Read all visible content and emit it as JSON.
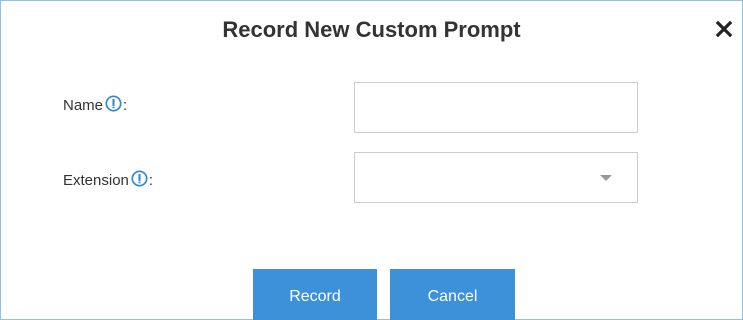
{
  "dialog": {
    "title": "Record New Custom Prompt",
    "close_icon": "close-icon"
  },
  "form": {
    "name": {
      "label": "Name",
      "colon": ":",
      "info_icon": "info-icon",
      "value": "",
      "placeholder": ""
    },
    "extension": {
      "label": "Extension",
      "colon": ":",
      "info_icon": "info-icon",
      "selected": "",
      "dropdown_icon": "chevron-down-icon"
    }
  },
  "buttons": {
    "record_label": "Record",
    "cancel_label": "Cancel"
  },
  "colors": {
    "accent": "#3d91d8",
    "border": "#8fc3e2",
    "info_icon": "#2a8ad4",
    "text": "#333333"
  }
}
